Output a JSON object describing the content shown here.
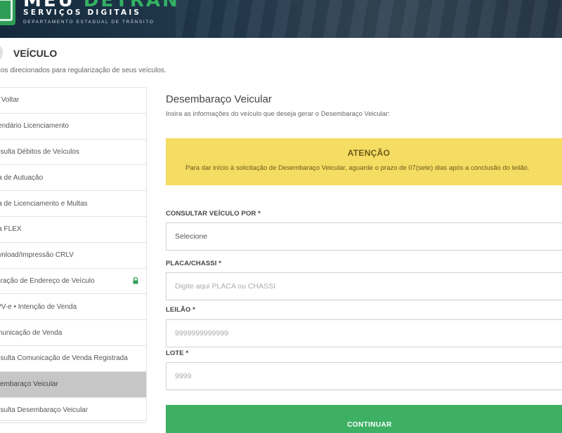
{
  "header": {
    "brand_main_white": "MEU ",
    "brand_main_green": "DETRAN",
    "brand_sub": "SERVIÇOS DIGITAIS",
    "brand_small": "DEPARTAMENTO ESTADUAL DE TRÂNSITO",
    "brand_color": "#34b162",
    "banner_color": "#1e3548"
  },
  "section": {
    "title": "VEÍCULO",
    "subtitle": "ços direcionados para regularização de seus veículos."
  },
  "sidebar": {
    "items": [
      {
        "label": "Voltar",
        "icon": "back-arrow-icon"
      },
      {
        "label": "lendário Licenciamento"
      },
      {
        "label": "nsulta Débitos de Veículos"
      },
      {
        "label": "ia de Autuação"
      },
      {
        "label": "ia de Licenciamento e Multas"
      },
      {
        "label": "ia FLEX"
      },
      {
        "label": "wnload/Impressão CRLV"
      },
      {
        "label": "eração de Endereço de Veículo",
        "icon": "lock-icon"
      },
      {
        "label": "PV-e • Intenção de Venda"
      },
      {
        "label": "municação de Venda"
      },
      {
        "label": "nsulta Comunicação de Venda Registrada"
      },
      {
        "label": "sembaraço Veicular",
        "active": true
      },
      {
        "label": "nsulta Desembaraço Veicular"
      }
    ],
    "active_color": "#c6c6c6"
  },
  "main": {
    "title": "Desembaraço Veicular",
    "description": "Insira as informações do veículo que deseja gerar o Desembaraço Veicular:",
    "alert": {
      "title": "ATENÇÃO",
      "text": "Para dar início à solicitação de Desembaraço Veicular, aguarde o prazo de 07(sete) dias após a conclusão do leilão.",
      "color": "#f5dc62"
    },
    "fields": {
      "consultar_label": "CONSULTAR VEÍCULO POR *",
      "consultar_value": "Selecione",
      "placa_label": "PLACA/CHASSI *",
      "placa_placeholder": "Digite aqui PLACA ou CHASSI",
      "leilao_label": "LEILÃO *",
      "leilao_placeholder": "9999999999999",
      "lote_label": "LOTE *",
      "lote_placeholder": "9999"
    },
    "continue_label": "CONTINUAR",
    "continue_color": "#3db063"
  }
}
